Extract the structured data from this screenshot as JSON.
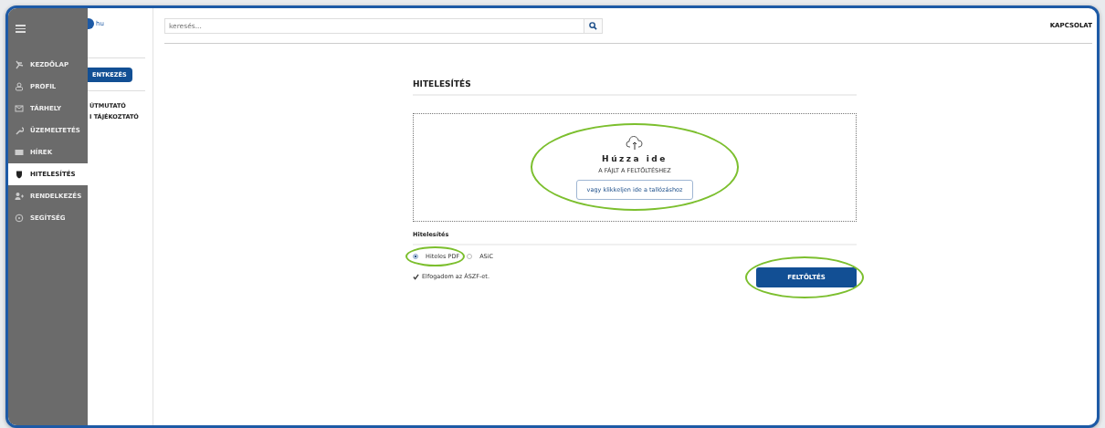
{
  "drawer": {
    "items": [
      {
        "label": "KEZDŐLAP",
        "selected": false
      },
      {
        "label": "PROFIL",
        "selected": false
      },
      {
        "label": "TÁRHELY",
        "selected": false
      },
      {
        "label": "ÜZEMELTETÉS",
        "selected": false
      },
      {
        "label": "HÍREK",
        "selected": false
      },
      {
        "label": "HITELESÍTÉS",
        "selected": true
      },
      {
        "label": "RENDELKEZÉS",
        "selected": false
      },
      {
        "label": "SEGÍTSÉG",
        "selected": false
      }
    ]
  },
  "left_panel": {
    "logo_text": "hu",
    "login_button": "ENTKEZÉS",
    "links": [
      "ÚTMUTATÓ",
      "I TÁJÉKOZTATÓ"
    ]
  },
  "header": {
    "search": {
      "placeholder": "keresés..."
    },
    "contact_link": "KAPCSOLAT"
  },
  "page": {
    "title": "HITELESÍTÉS",
    "dropzone": {
      "heading": "Húzza ide",
      "subheading": "A FÁJLT A FELTÖLTÉSHEZ",
      "browse_button": "vagy klikkeljen ide a tallózáshoz",
      "highlighted": true
    },
    "section_label": "Hitelesítés",
    "options": [
      {
        "label": "Hiteles PDF",
        "selected": true,
        "highlighted": true
      },
      {
        "label": "ASiC",
        "selected": false,
        "highlighted": false
      }
    ],
    "accept": {
      "label": "Elfogadom az ÁSZF-et.",
      "checked": true
    },
    "upload_button": {
      "label": "FELTÖLTÉS",
      "highlighted": true
    }
  }
}
